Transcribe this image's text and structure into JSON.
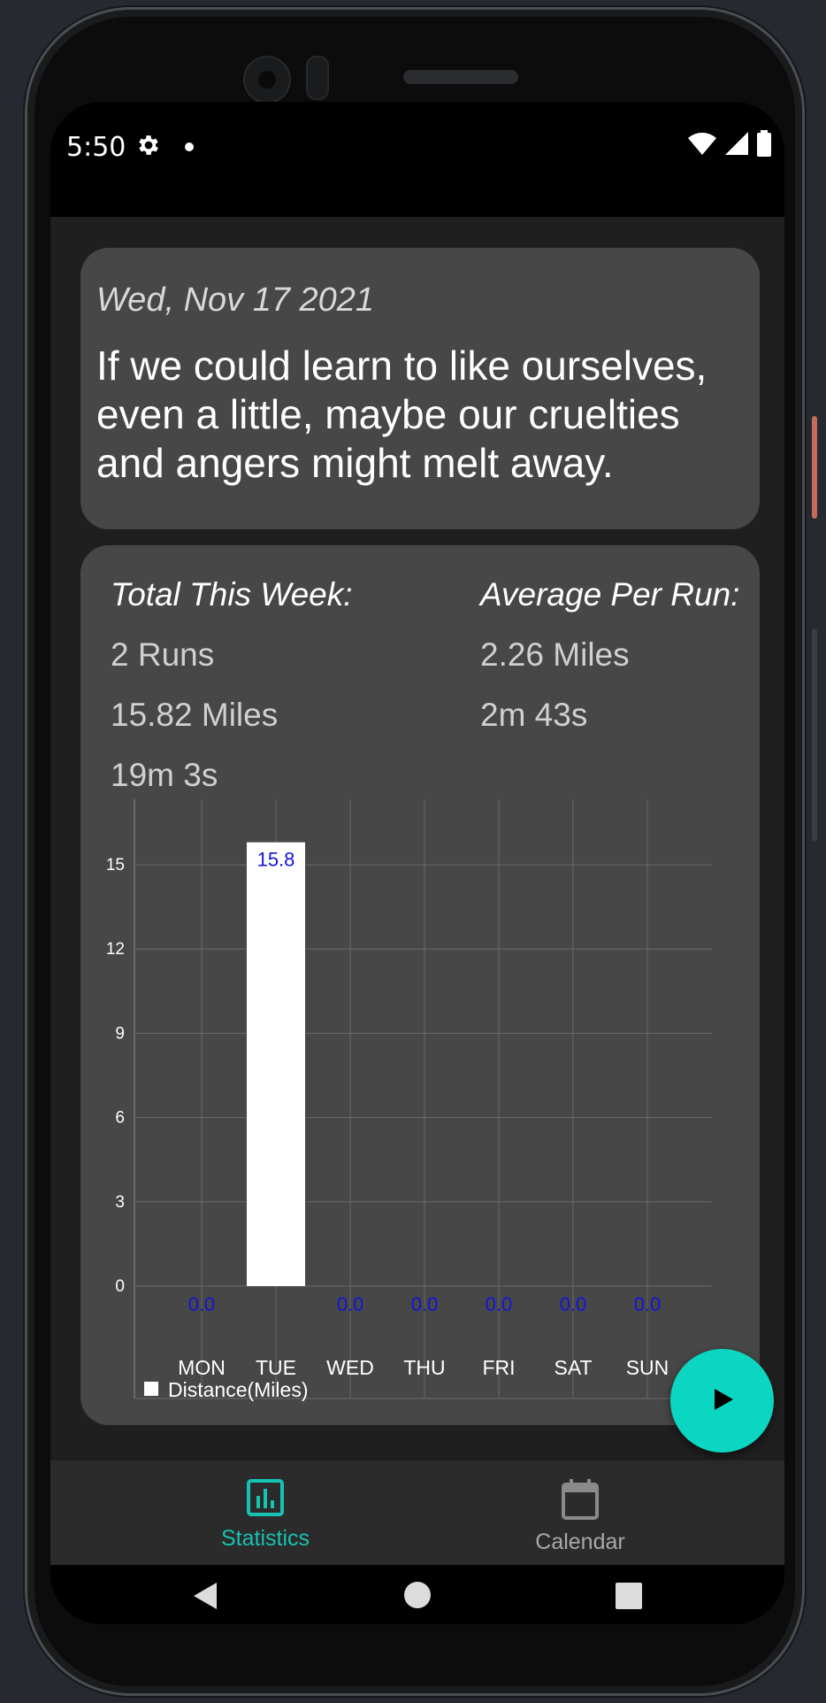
{
  "status_bar": {
    "time": "5:50"
  },
  "quote": {
    "date": "Wed, Nov 17 2021",
    "text": "If we could learn to like ourselves, even a little, maybe our cruelties and angers might melt away."
  },
  "stats": {
    "total_heading": "Total This Week:",
    "total_runs": "2 Runs",
    "total_miles": "15.82 Miles",
    "total_time": "19m 3s",
    "avg_heading": "Average Per Run:",
    "avg_miles": "2.26 Miles",
    "avg_time": "2m 43s"
  },
  "chart_data": {
    "type": "bar",
    "categories": [
      "MON",
      "TUE",
      "WED",
      "THU",
      "FRI",
      "SAT",
      "SUN"
    ],
    "series": [
      {
        "name": "Distance(Miles)",
        "values": [
          0.0,
          15.8,
          0.0,
          0.0,
          0.0,
          0.0,
          0.0
        ]
      }
    ],
    "value_labels": [
      "0.0",
      "15.8",
      "0.0",
      "0.0",
      "0.0",
      "0.0",
      "0.0"
    ],
    "y_ticks": [
      "0",
      "3",
      "6",
      "9",
      "12",
      "15"
    ],
    "ylim": [
      0,
      17
    ],
    "grid": true,
    "legend": "bottom-left",
    "bar_color": "#ffffff",
    "value_label_color": "#1414d9"
  },
  "bottom_nav": {
    "statistics_label": "Statistics",
    "calendar_label": "Calendar",
    "active_color": "#16c2b2",
    "inactive_color": "#a8a8a8"
  },
  "fab": {
    "icon": "play-icon",
    "color": "#0bd6c1"
  }
}
